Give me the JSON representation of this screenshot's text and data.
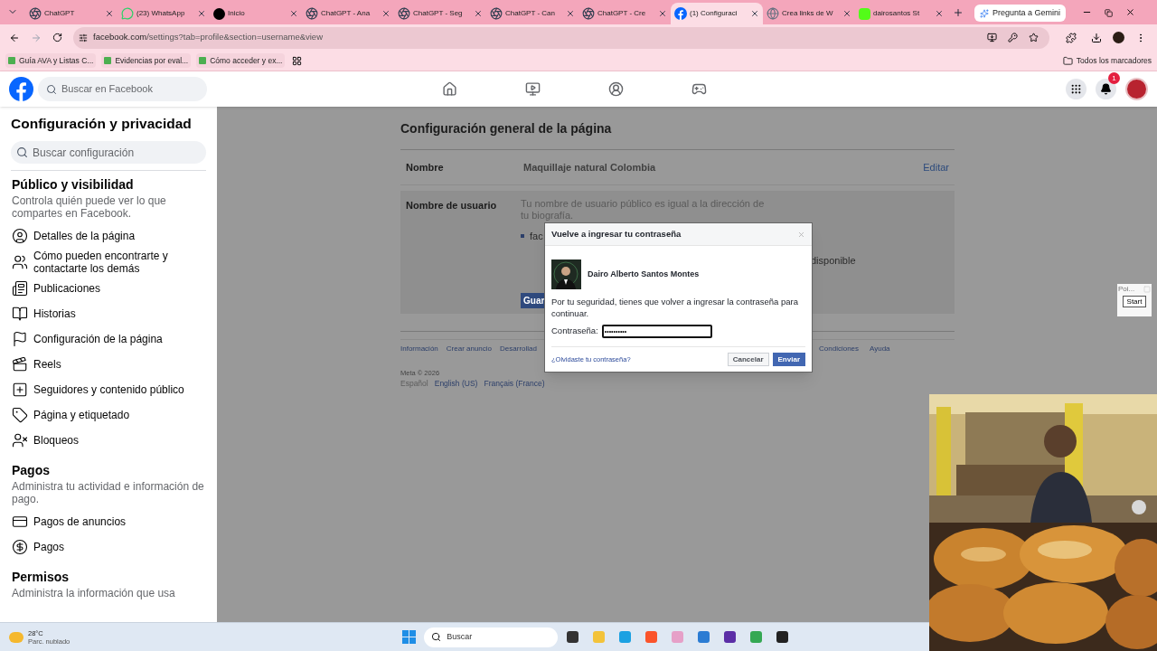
{
  "browser": {
    "tabs": [
      {
        "title": "ChatGPT",
        "kind": "chatgpt",
        "selected": false
      },
      {
        "title": "(23) WhatsApp",
        "kind": "whatsapp",
        "selected": false
      },
      {
        "title": "Inicio",
        "kind": "dark",
        "selected": false
      },
      {
        "title": "ChatGPT - Ana",
        "kind": "chatgpt",
        "selected": false
      },
      {
        "title": "ChatGPT - Seg",
        "kind": "chatgpt",
        "selected": false
      },
      {
        "title": "ChatGPT - Can",
        "kind": "chatgpt",
        "selected": false
      },
      {
        "title": "ChatGPT - Cre",
        "kind": "chatgpt",
        "selected": false
      },
      {
        "title": "(1) Configuraci",
        "kind": "facebook",
        "selected": true
      },
      {
        "title": "Crea links de W",
        "kind": "web",
        "selected": false
      },
      {
        "title": "dairosantos St",
        "kind": "green",
        "selected": false
      }
    ],
    "gemini_button": "Pregunta a Gemini",
    "url_host": "facebook.com",
    "url_path": "/settings?tab=profile&section=username&view",
    "bookmarks": [
      "Guía AVA y Listas C...",
      "Evidencias por eval...",
      "Cómo acceder y ex..."
    ],
    "all_bookmarks": "Todos los marcadores"
  },
  "facebook_header": {
    "search_placeholder": "Buscar en Facebook",
    "notification_count": "1"
  },
  "sidebar": {
    "title": "Configuración y privacidad",
    "search_placeholder": "Buscar configuración",
    "sections": [
      {
        "title": "Público y visibilidad",
        "description": "Controla quién puede ver lo que compartes en Facebook.",
        "items": [
          "Detalles de la página",
          "Cómo pueden encontrarte y contactarte los demás",
          "Publicaciones",
          "Historias",
          "Configuración de la página",
          "Reels",
          "Seguidores y contenido público",
          "Página y etiquetado",
          "Bloqueos"
        ]
      },
      {
        "title": "Pagos",
        "description": "Administra tu actividad e información de pago.",
        "items": [
          "Pagos de anuncios",
          "Pagos"
        ]
      },
      {
        "title": "Permisos",
        "description": "Administra la información que usa"
      }
    ]
  },
  "settings": {
    "title": "Configuración general de la página",
    "name_row": {
      "label": "Nombre",
      "value": "Maquillaje natural Colombia",
      "action": "Editar"
    },
    "username_row": {
      "label": "Nombre de usuario",
      "description": "Tu nombre de usuario público es igual a la dirección de tu biografía.",
      "bullet": "fac",
      "status": "disponible",
      "save_button": "Guar"
    },
    "footer_links_left": [
      "Información",
      "Crear anuncio",
      "Desarrollad"
    ],
    "footer_links_right": [
      "Condiciones",
      "Ayuda"
    ],
    "copyright": "Meta © 2026",
    "languages": [
      {
        "label": "Español",
        "selected": true
      },
      {
        "label": "English (US)",
        "selected": false
      },
      {
        "label": "Français (France)",
        "selected": false
      }
    ]
  },
  "dialog": {
    "title": "Vuelve a ingresar tu contraseña",
    "user_name": "Dairo Alberto Santos Montes",
    "message": "Por tu seguridad, tienes que volver a ingresar la contraseña para continuar.",
    "password_label": "Contraseña:",
    "password_value": "••••••••••",
    "forgot_link": "¿Olvidaste tu contraseña?",
    "cancel_button": "Cancelar",
    "submit_button": "Enviar"
  },
  "side_widget": {
    "label": "Poi...",
    "button": "Start"
  },
  "taskbar": {
    "temperature": "28°C",
    "weather": "Parc. nublado",
    "search_placeholder": "Buscar"
  }
}
